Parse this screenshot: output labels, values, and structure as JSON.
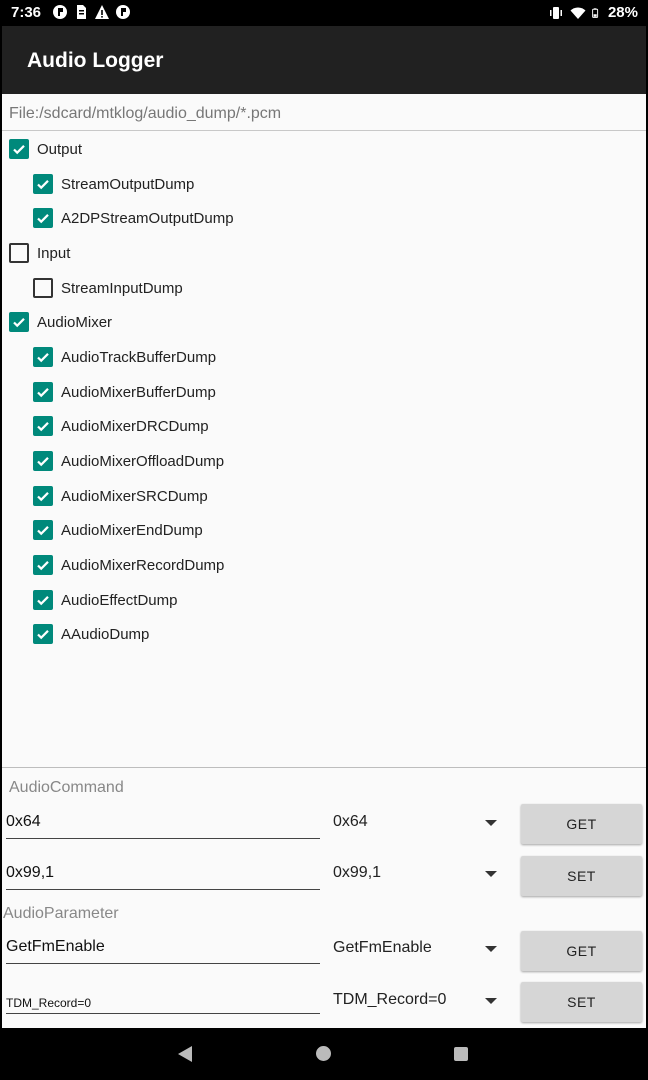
{
  "status_bar": {
    "time": "7:36",
    "battery": "28%"
  },
  "app": {
    "title": "Audio Logger",
    "path": "File:/sdcard/mtklog/audio_dump/*.pcm"
  },
  "checkboxes": {
    "output": {
      "label": "Output",
      "checked": true
    },
    "stream_output_dump": {
      "label": "StreamOutputDump",
      "checked": true
    },
    "a2dp_stream_output_dump": {
      "label": "A2DPStreamOutputDump",
      "checked": true
    },
    "input": {
      "label": "Input",
      "checked": false
    },
    "stream_input_dump": {
      "label": "StreamInputDump",
      "checked": false
    },
    "audio_mixer": {
      "label": "AudioMixer",
      "checked": true
    },
    "audio_track_buffer_dump": {
      "label": "AudioTrackBufferDump",
      "checked": true
    },
    "audio_mixer_buffer_dump": {
      "label": "AudioMixerBufferDump",
      "checked": true
    },
    "audio_mixer_drc_dump": {
      "label": "AudioMixerDRCDump",
      "checked": true
    },
    "audio_mixer_offload_dump": {
      "label": "AudioMixerOffloadDump",
      "checked": true
    },
    "audio_mixer_src_dump": {
      "label": "AudioMixerSRCDump",
      "checked": true
    },
    "audio_mixer_end_dump": {
      "label": "AudioMixerEndDump",
      "checked": true
    },
    "audio_mixer_record_dump": {
      "label": "AudioMixerRecordDump",
      "checked": true
    },
    "audio_effect_dump": {
      "label": "AudioEffectDump",
      "checked": true
    },
    "aaudio_dump": {
      "label": "AAudioDump",
      "checked": true
    }
  },
  "audio_command": {
    "label": "AudioCommand",
    "row1": {
      "input": "0x64",
      "spinner": "0x64",
      "button": "GET"
    },
    "row2": {
      "input": "0x99,1",
      "spinner": "0x99,1",
      "button": "SET"
    }
  },
  "audio_parameter": {
    "label": "AudioParameter",
    "row1": {
      "input": "GetFmEnable",
      "spinner": "GetFmEnable",
      "button": "GET"
    },
    "row2": {
      "input": "TDM_Record=0",
      "spinner": "TDM_Record=0",
      "button": "SET"
    }
  },
  "colors": {
    "accent": "#00897b",
    "app_bar": "#212121"
  }
}
